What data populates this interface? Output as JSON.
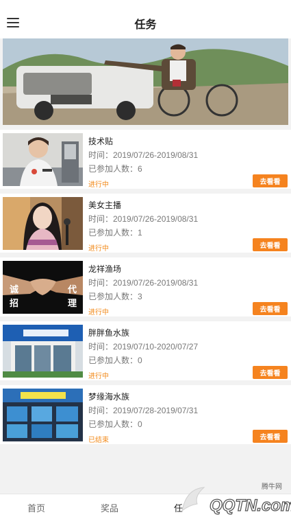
{
  "header": {
    "title": "任务"
  },
  "tasks": [
    {
      "name": "技术贴",
      "time": "时间：2019/07/26-2019/08/31",
      "count": "已参加人数：6",
      "status": "进行中",
      "action": "去看看"
    },
    {
      "name": "美女主播",
      "time": "时间：2019/07/26-2019/08/31",
      "count": "已参加人数：1",
      "status": "进行中",
      "action": "去看看"
    },
    {
      "name": "龙祥渔场",
      "time": "时间：2019/07/26-2019/08/31",
      "count": "已参加人数：3",
      "status": "进行中",
      "action": "去看看",
      "thumb_text": [
        "诚",
        "招",
        "代",
        "理"
      ]
    },
    {
      "name": "胖胖鱼水族",
      "time": "时间：2019/07/10-2020/07/27",
      "count": "已参加人数：0",
      "status": "进行中",
      "action": "去看看"
    },
    {
      "name": "梦缘海水族",
      "time": "时间：2019/07/28-2019/07/31",
      "count": "已参加人数：0",
      "status": "已结束",
      "action": "去看看"
    }
  ],
  "tabbar": {
    "home": "首页",
    "prize": "奖品",
    "task": "任"
  },
  "watermark": {
    "brand_small": "腾牛网",
    "brand_large": "QQTN.com"
  },
  "colors": {
    "accent": "#f5831f",
    "status": "#f28a1a",
    "background": "#f2f2f2"
  }
}
